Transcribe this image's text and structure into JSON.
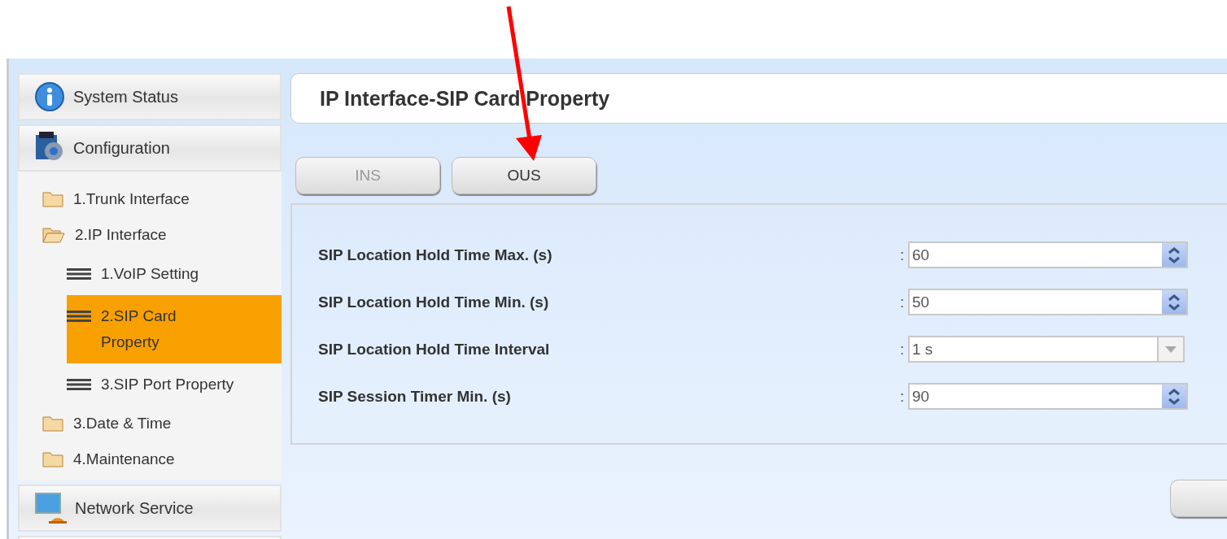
{
  "sidebar": {
    "sections_top": [
      {
        "label": "System Status"
      },
      {
        "label": "Configuration"
      }
    ],
    "tree": [
      {
        "label": "1.Trunk Interface",
        "expanded": false
      },
      {
        "label": "2.IP Interface",
        "expanded": true,
        "children": [
          {
            "label": "1.VoIP Setting",
            "selected": false
          },
          {
            "label": "2.SIP Card Property",
            "selected": true
          },
          {
            "label": "3.SIP Port Property",
            "selected": false
          }
        ]
      },
      {
        "label": "3.Date & Time",
        "expanded": false
      },
      {
        "label": "4.Maintenance",
        "expanded": false
      }
    ],
    "sections_bottom": [
      {
        "label": "Network Service"
      }
    ]
  },
  "page": {
    "title": "IP Interface-SIP Card Property",
    "tabs": [
      {
        "label": "INS",
        "selected": false
      },
      {
        "label": "OUS",
        "selected": true
      }
    ],
    "fields": [
      {
        "label": "SIP Location Hold Time Max. (s)",
        "separator": ":",
        "kind": "spin",
        "value": "60"
      },
      {
        "label": "SIP Location Hold Time Min. (s)",
        "separator": ":",
        "kind": "spin",
        "value": "50"
      },
      {
        "label": "SIP Location Hold Time Interval",
        "separator": ":",
        "kind": "select",
        "value": "1 s"
      },
      {
        "label": "SIP Session Timer Min. (s)",
        "separator": ":",
        "kind": "spin",
        "value": "90"
      }
    ]
  }
}
